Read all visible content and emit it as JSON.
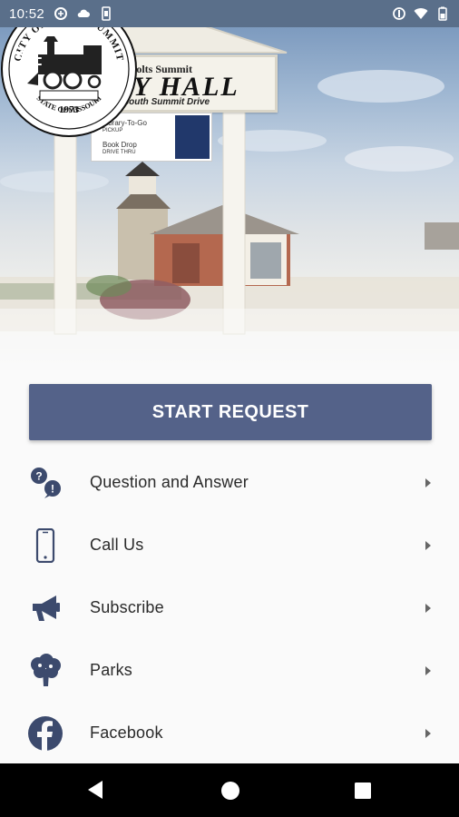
{
  "status_bar": {
    "time": "10:52",
    "left_icons": [
      "data-saver-icon",
      "cloud-icon",
      "phone-storage-icon"
    ],
    "right_icons": [
      "vpn-key-icon",
      "wifi-icon",
      "battery-icon"
    ]
  },
  "hero": {
    "sign": {
      "top_line": "Holts Summit",
      "title": "CITY HALL",
      "address": "213 South Summit Drive"
    },
    "small_sign": {
      "line1": "Library-To-Go",
      "line1_sub": "PICKUP",
      "line2": "Book Drop",
      "line2_sub": "DRIVE THRU"
    },
    "seal": {
      "outer_text": "CITY OF HOLTS SUMMIT",
      "year": "1973",
      "bottom_text": "STATE OF MISSOURI"
    }
  },
  "start_button": {
    "label": "START REQUEST"
  },
  "menu": {
    "items": [
      {
        "label": "Question and Answer",
        "icon": "question-answer-icon"
      },
      {
        "label": "Call Us",
        "icon": "phone-icon"
      },
      {
        "label": "Subscribe",
        "icon": "megaphone-icon"
      },
      {
        "label": "Parks",
        "icon": "tree-icon"
      },
      {
        "label": "Facebook",
        "icon": "facebook-icon"
      }
    ]
  },
  "nav_bar": {
    "buttons": [
      "back-icon",
      "home-icon",
      "recents-icon"
    ]
  },
  "colors": {
    "accent": "#546289",
    "icon": "#3c4a6d",
    "status_bar": "#5a6f8a"
  }
}
